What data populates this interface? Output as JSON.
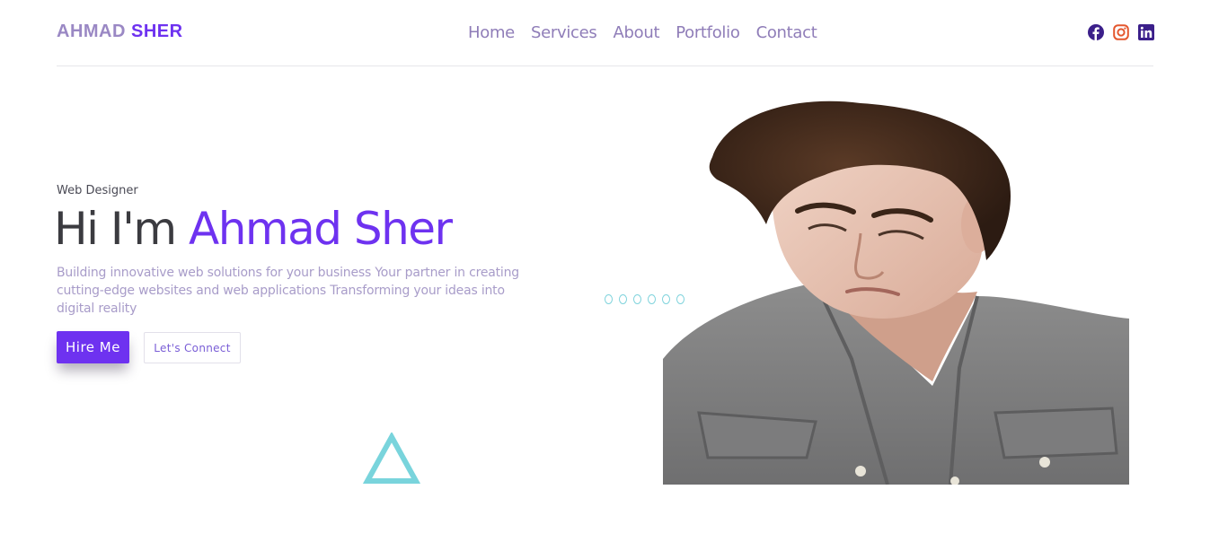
{
  "brand": {
    "first": "AHMAD",
    "last": "SHER"
  },
  "nav": {
    "items": [
      {
        "label": "Home"
      },
      {
        "label": "Services"
      },
      {
        "label": "About"
      },
      {
        "label": "Portfolio"
      },
      {
        "label": "Contact"
      }
    ]
  },
  "social": {
    "icons": [
      "facebook-icon",
      "instagram-icon",
      "linkedin-icon"
    ],
    "colors": {
      "facebook": "#3b1f8a",
      "instagram": "#e4572e",
      "linkedin": "#3b1f8a"
    }
  },
  "hero": {
    "eyebrow": "Web Designer",
    "greeting": "Hi I'm",
    "name": "Ahmad Sher",
    "description": "Building innovative web solutions for your business Your partner in creating cutting-edge websites and web applications Transforming your ideas into digital reality",
    "primary_button": "Hire Me",
    "secondary_button": "Let's Connect"
  },
  "decor": {
    "dot_count": 6,
    "accent": "#6e32f0",
    "teal": "#79d4dc"
  }
}
